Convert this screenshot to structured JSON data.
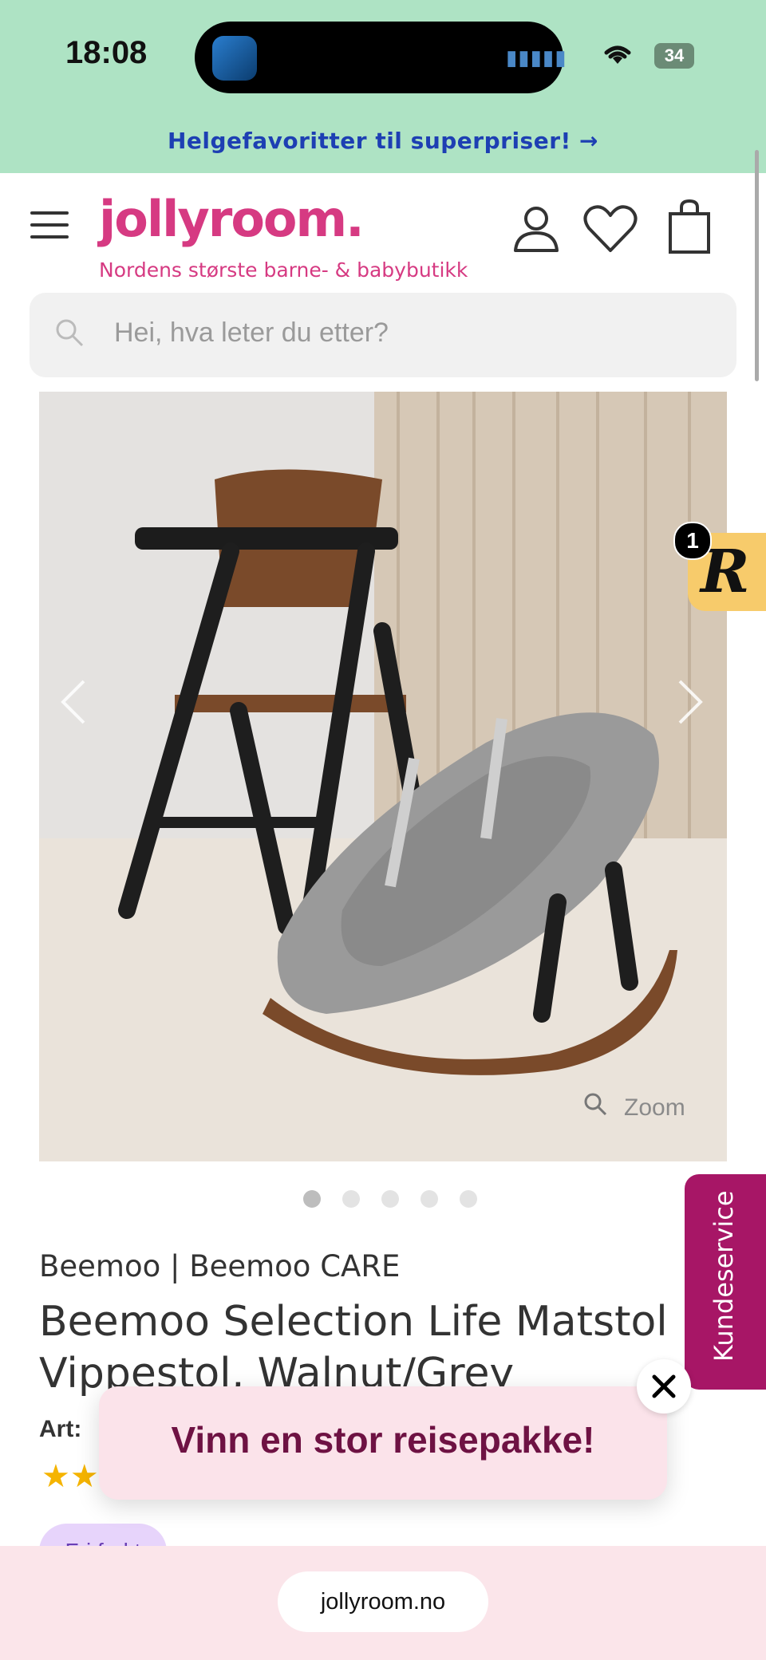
{
  "status_bar": {
    "time": "18:08",
    "battery": "34"
  },
  "promo_banner": {
    "text": "Helgefavoritter til superpriser! →"
  },
  "header": {
    "logo": "jollyroom.",
    "tagline": "Nordens største barne- & babybutikk",
    "icons": [
      "menu-icon",
      "user-icon",
      "heart-icon",
      "shopping-bag-icon"
    ]
  },
  "search": {
    "placeholder": "Hei, hva leter du etter?"
  },
  "gallery": {
    "zoom_label": "Zoom",
    "image_count": 5,
    "active_index": 0
  },
  "reviews_badge": {
    "letter": "R",
    "count": "1"
  },
  "product": {
    "brand": "Beemoo | Beemoo CARE",
    "title_line1": "Beemoo Selection Life Matstol Inkl.",
    "title_line2": "Vippestol, Walnut/Grey",
    "art_label": "Art:",
    "stars": "★★",
    "badge": "Fri frakt"
  },
  "kundeservice": {
    "label": "Kundeservice"
  },
  "popup": {
    "text": "Vinn en stor reisepakke!"
  },
  "browser": {
    "url": "jollyroom.no"
  },
  "colors": {
    "brand_pink": "#d63a82",
    "promo_green": "#aee3c4",
    "service_magenta": "#a71666"
  }
}
